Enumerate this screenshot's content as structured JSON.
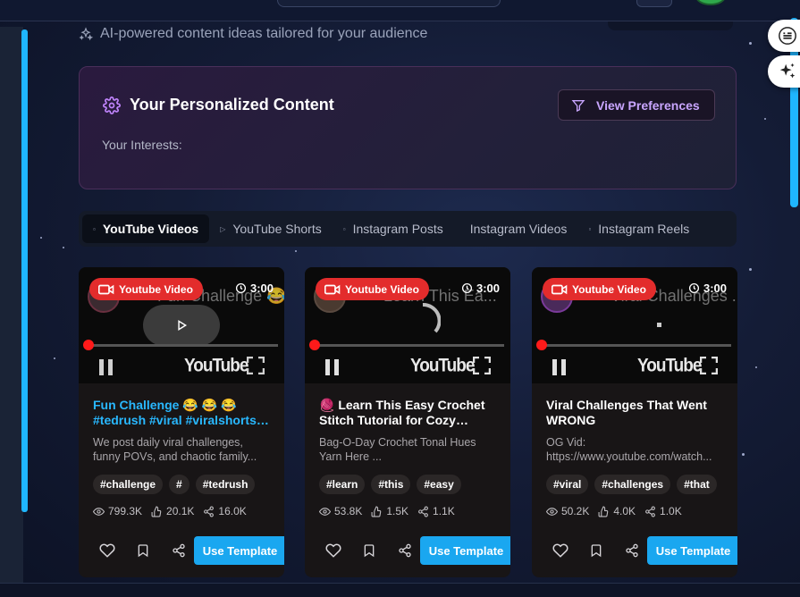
{
  "subtitle": "AI-powered content ideas tailored for your audience",
  "personalized": {
    "title": "Your Personalized Content",
    "interests_label": "Your Interests:",
    "view_preferences": "View Preferences"
  },
  "tabs": [
    {
      "label": "YouTube Videos",
      "active": true
    },
    {
      "label": "YouTube Shorts",
      "active": false
    },
    {
      "label": "Instagram Posts",
      "active": false
    },
    {
      "label": "Instagram Videos",
      "active": false
    },
    {
      "label": "Instagram Reels",
      "active": false
    }
  ],
  "cards": [
    {
      "badge": "Youtube Video",
      "duration": "3:00",
      "ghost_title": "Fun Challenge 😂 ...",
      "title": "Fun Challenge 😂 😂 😂 #tedrush #viral #viralshorts #shorts",
      "title_color": "blue",
      "description": "We post daily viral challenges, funny POVs, and chaotic family...",
      "tags": [
        "#challenge",
        "#",
        "#tedrush"
      ],
      "views": "799.3K",
      "likes": "20.1K",
      "shares": "16.0K",
      "cta": "Use Template",
      "player_logo": "YouTube"
    },
    {
      "badge": "Youtube Video",
      "duration": "3:00",
      "ghost_title": "Learn This Ea...",
      "title": "🧶 Learn This Easy Crochet Stitch Tutorial for Cozy Blankets",
      "title_color": "white",
      "description": "Bag-O-Day Crochet Tonal Hues Yarn Here ...",
      "tags": [
        "#learn",
        "#this",
        "#easy"
      ],
      "views": "53.8K",
      "likes": "1.5K",
      "shares": "1.1K",
      "cta": "Use Template",
      "player_logo": "YouTube"
    },
    {
      "badge": "Youtube Video",
      "duration": "3:00",
      "ghost_title": "Viral Challenges ...",
      "title": "Viral Challenges That Went WRONG",
      "title_color": "white",
      "description": "OG Vid: https://www.youtube.com/watch...",
      "tags": [
        "#viral",
        "#challenges",
        "#that"
      ],
      "views": "50.2K",
      "likes": "4.0K",
      "shares": "1.0K",
      "cta": "Use Template",
      "player_logo": "YouTube"
    }
  ],
  "colors": {
    "accent": "#1aa7f0",
    "badge_red": "#e32c2c",
    "purple_accent": "#c9a6ff"
  }
}
